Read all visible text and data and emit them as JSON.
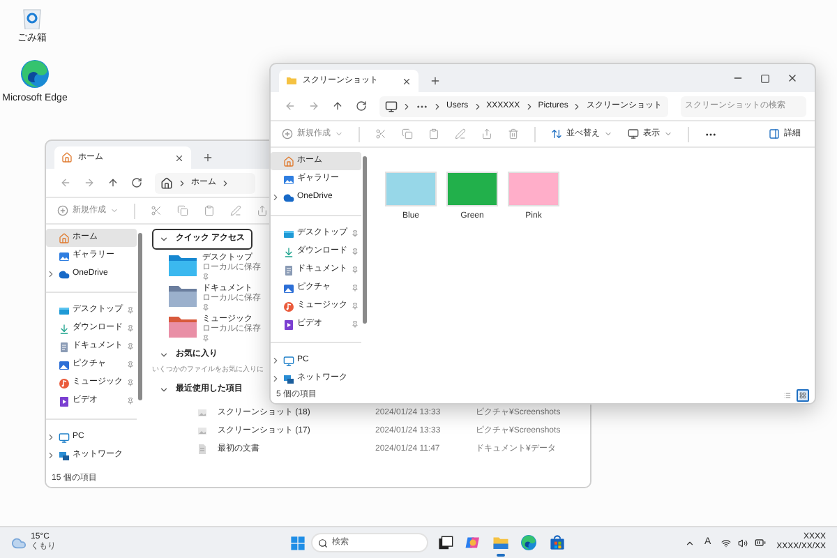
{
  "desktop_icons": [
    {
      "label": "ごみ箱"
    },
    {
      "label": "Microsoft Edge"
    }
  ],
  "windows": [
    {
      "kind": "home",
      "controls_visible": false,
      "tab": {
        "title": "ホーム"
      },
      "address_overflow": false,
      "address": [
        "ホーム"
      ],
      "trailing_chevron": true,
      "toolbar": {
        "new_label": "新規作成"
      },
      "sidebar": [
        [
          {
            "label": "ホーム",
            "selected": true,
            "pinned": false,
            "expandable": false
          },
          {
            "label": "ギャラリー",
            "selected": false,
            "pinned": false,
            "expandable": false
          },
          {
            "label": "OneDrive",
            "selected": false,
            "pinned": false,
            "expandable": true
          }
        ],
        [
          {
            "label": "デスクトップ",
            "selected": false,
            "pinned": true,
            "expandable": false
          },
          {
            "label": "ダウンロード",
            "selected": false,
            "pinned": true,
            "expandable": false
          },
          {
            "label": "ドキュメント",
            "selected": false,
            "pinned": true,
            "expandable": false
          },
          {
            "label": "ピクチャ",
            "selected": false,
            "pinned": true,
            "expandable": false
          },
          {
            "label": "ミュージック",
            "selected": false,
            "pinned": true,
            "expandable": false
          },
          {
            "label": "ビデオ",
            "selected": false,
            "pinned": true,
            "expandable": false
          }
        ],
        [
          {
            "label": "PC",
            "selected": false,
            "pinned": false,
            "expandable": true
          },
          {
            "label": "ネットワーク",
            "selected": false,
            "pinned": false,
            "expandable": true
          }
        ]
      ],
      "sections": [
        {
          "kind": "tiles",
          "title": "クイック アクセス",
          "expanded": true,
          "focused": true,
          "items": [
            {
              "name": "デスクトップ",
              "detail": "ローカルに保存",
              "pinned": true
            },
            {
              "name": "ドキュメント",
              "detail": "ローカルに保存",
              "pinned": true
            },
            {
              "name": "ミュージック",
              "detail": "ローカルに保存",
              "pinned": true
            }
          ]
        },
        {
          "kind": "note",
          "title": "お気に入り",
          "expanded": true,
          "focused": false,
          "text": "いくつかのファイルをお気に入りに"
        },
        {
          "kind": "list",
          "title": "最近使用した項目",
          "expanded": true,
          "focused": false,
          "items": [
            {
              "name": "スクリーンショット (18)",
              "date": "2024/01/24 13:33",
              "location": "ピクチャ¥Screenshots"
            },
            {
              "name": "スクリーンショット (17)",
              "date": "2024/01/24 13:33",
              "location": "ピクチャ¥Screenshots"
            },
            {
              "name": "最初の文書",
              "date": "2024/01/24 11:47",
              "location": "ドキュメント¥データ"
            }
          ]
        }
      ],
      "status": "15 個の項目"
    },
    {
      "kind": "folder",
      "controls_visible": true,
      "tab": {
        "title": "スクリーンショット"
      },
      "address_overflow": true,
      "address": [
        "Users",
        "XXXXXX",
        "Pictures",
        "スクリーンショット"
      ],
      "trailing_chevron": false,
      "search": {
        "placeholder": "スクリーンショットの検索"
      },
      "toolbar": {
        "new_label": "新規作成",
        "sort_label": "並べ替え",
        "view_label": "表示",
        "details_label": "詳細"
      },
      "sidebar": [
        [
          {
            "label": "ホーム",
            "selected": true,
            "pinned": false,
            "expandable": false
          },
          {
            "label": "ギャラリー",
            "selected": false,
            "pinned": false,
            "expandable": false
          },
          {
            "label": "OneDrive",
            "selected": false,
            "pinned": false,
            "expandable": true
          }
        ],
        [
          {
            "label": "デスクトップ",
            "selected": false,
            "pinned": true,
            "expandable": false
          },
          {
            "label": "ダウンロード",
            "selected": false,
            "pinned": true,
            "expandable": false
          },
          {
            "label": "ドキュメント",
            "selected": false,
            "pinned": true,
            "expandable": false
          },
          {
            "label": "ピクチャ",
            "selected": false,
            "pinned": true,
            "expandable": false
          },
          {
            "label": "ミュージック",
            "selected": false,
            "pinned": true,
            "expandable": false
          },
          {
            "label": "ビデオ",
            "selected": false,
            "pinned": true,
            "expandable": false
          }
        ],
        [
          {
            "label": "PC",
            "selected": false,
            "pinned": false,
            "expandable": true
          },
          {
            "label": "ネットワーク",
            "selected": false,
            "pinned": false,
            "expandable": true
          }
        ]
      ],
      "items": [
        {
          "name": "Blue",
          "color": "#97d7e8"
        },
        {
          "name": "Green",
          "color": "#22b04b"
        },
        {
          "name": "Pink",
          "color": "#ffaec9"
        }
      ],
      "status": "5 個の項目",
      "view_modes": [
        {
          "kind": "details",
          "selected": false
        },
        {
          "kind": "tiles",
          "selected": true
        }
      ]
    }
  ],
  "taskbar": {
    "weather": {
      "temperature": "15°C",
      "condition": "くもり"
    },
    "search": {
      "placeholder": "検索"
    },
    "apps": [
      {
        "active": false
      },
      {
        "active": false
      },
      {
        "active": true
      },
      {
        "active": false
      },
      {
        "active": false
      }
    ],
    "ime": "A",
    "clock": {
      "time": "XXXX",
      "date": "XXXX/XX/XX"
    }
  }
}
